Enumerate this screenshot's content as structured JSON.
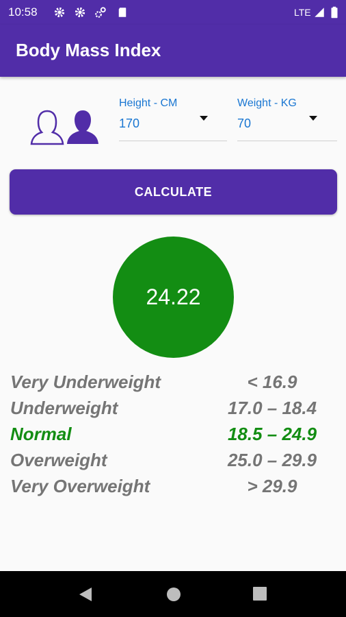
{
  "status_bar": {
    "time": "10:58",
    "network": "LTE",
    "icons": [
      "settings-icon",
      "settings-icon",
      "sync-icon",
      "sd-card-icon",
      "signal-icon",
      "battery-icon"
    ]
  },
  "app_bar": {
    "title": "Body Mass Index"
  },
  "gender": {
    "options": [
      "female",
      "male"
    ],
    "selected": "male"
  },
  "height_field": {
    "label": "Height - CM",
    "value": "170"
  },
  "weight_field": {
    "label": "Weight - KG",
    "value": "70"
  },
  "calculate_button": {
    "label": "CALCULATE"
  },
  "result": {
    "value": "24.22",
    "color": "#138D13"
  },
  "categories": [
    {
      "name": "Very Underweight",
      "range": "< 16.9",
      "color": "#757575"
    },
    {
      "name": "Underweight",
      "range": "17.0 – 18.4",
      "color": "#757575"
    },
    {
      "name": "Normal",
      "range": "18.5 – 24.9",
      "color": "#138D13"
    },
    {
      "name": "Overweight",
      "range": "25.0 – 29.9",
      "color": "#757575"
    },
    {
      "name": "Very Overweight",
      "range": "> 29.9",
      "color": "#757575"
    }
  ],
  "colors": {
    "primary": "#512DA8",
    "accent": "#1976D2"
  },
  "nav_bar": {
    "buttons": [
      "back-icon",
      "home-icon",
      "recents-icon"
    ]
  }
}
